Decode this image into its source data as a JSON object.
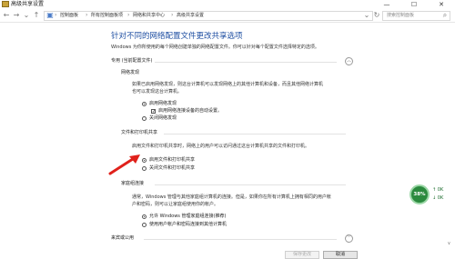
{
  "window": {
    "title": "高级共享设置",
    "minimize_glyph": "—",
    "maximize_glyph": "☐",
    "close_glyph": "✕"
  },
  "address": {
    "back_glyph": "←",
    "forward_glyph": "→",
    "dropdown_glyph": "⌄",
    "up_glyph": "↑",
    "home_glyph": "▣",
    "crumbs": [
      "控制面板",
      "所有控制面板项",
      "网络和共享中心",
      "高级共享设置"
    ],
    "separator": "›",
    "refresh_glyph": "↻",
    "search_placeholder": "搜索控制面板",
    "search_icon_glyph": "⌕"
  },
  "content": {
    "heading": "针对不同的网络配置文件更改共享选项",
    "subtitle": "Windows 为你所使用的每个网络创建单独的网络配置文件。你可以针对每个配置文件选择特定的选项。",
    "profile_header": "专用 (当前配置文件)",
    "network_discovery": {
      "title": "网络发现",
      "desc_line1": "如果已启用网络发现，则这台计算机可以发现网络上的其他计算机和设备，而且其他网络计算机",
      "desc_line2": "也可以发现这台计算机。",
      "opt_on": "启用网络发现",
      "opt_auto": "启用网络连接设备的自动设置。",
      "opt_off": "关闭网络发现"
    },
    "file_printer": {
      "title": "文件和打印机共享",
      "desc": "启用文件和打印机共享时，网络上的用户可以访问通过这台计算机共享的文件和打印机。",
      "opt_on": "启用文件和打印机共享",
      "opt_off": "关闭文件和打印机共享"
    },
    "homegroup": {
      "title": "家庭组连接",
      "desc_line1": "通常，Windows 管理与其他家庭组计算机的连接。但是，如果你在所有计算机上拥有相同的用户帐",
      "desc_line2": "户和密码，则可以让家庭组使用你的帐户。",
      "opt_allow": "允许 Windows 管理家庭组连接(推荐)",
      "opt_user": "使用用户帐户和密码连接到其他计算机"
    },
    "guest_header": "来宾或公用",
    "chevron_up": "︿",
    "chevron_down": "﹀"
  },
  "footer": {
    "save_label": "保存更改",
    "cancel_label": "取消",
    "scroll_glyph": "∨"
  },
  "netmon": {
    "percent": "38%",
    "up": "↑ 0K",
    "down": "↓ 0K"
  },
  "colors": {
    "heading": "#1f4fa2",
    "arrow": "#e0211b",
    "netmon": "#2b8a3e"
  }
}
